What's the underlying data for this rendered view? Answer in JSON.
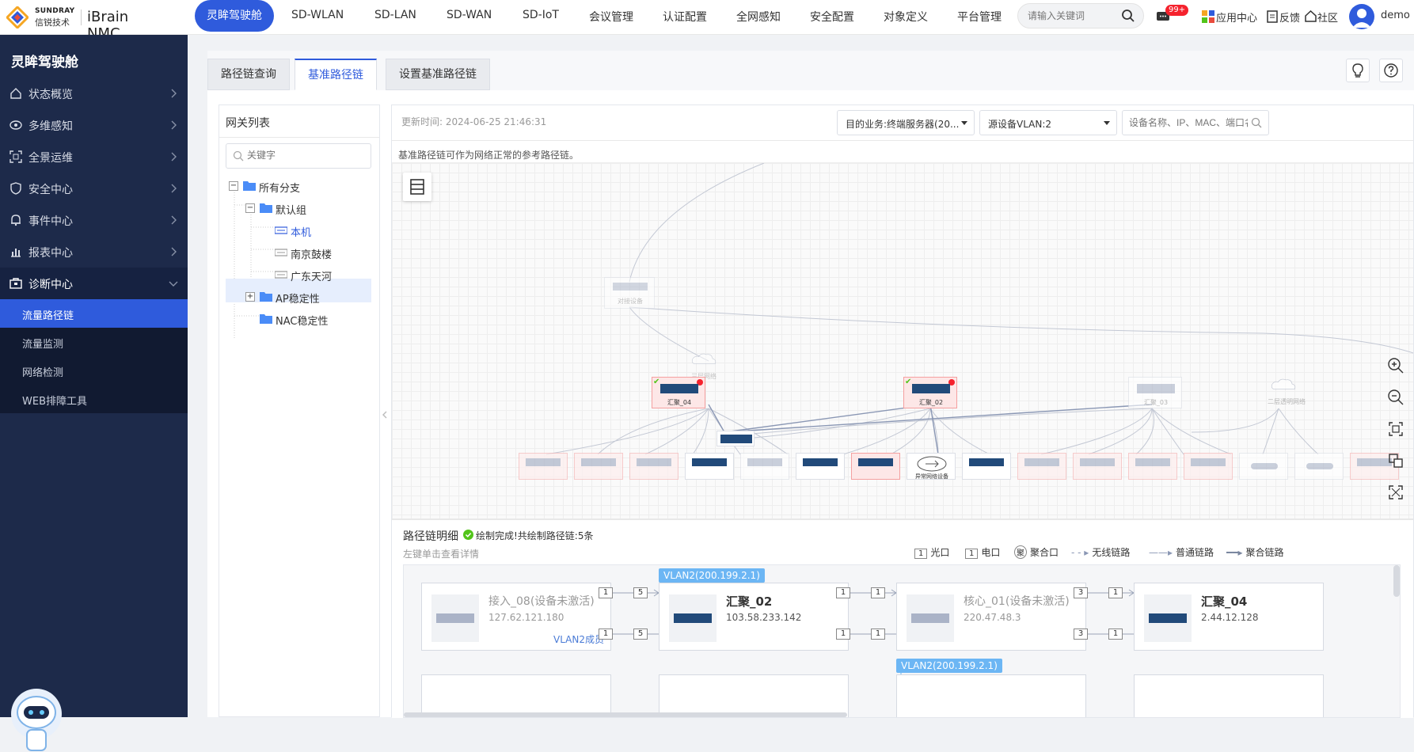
{
  "brand": {
    "company_en": "SUNDRAY",
    "company_cn": "信锐技术",
    "app": "iBrain NMC"
  },
  "nav": {
    "items": [
      "灵眸驾驶舱",
      "SD-WLAN",
      "SD-LAN",
      "SD-WAN",
      "SD-IoT",
      "会议管理",
      "认证配置",
      "全网感知",
      "安全配置",
      "对象定义",
      "平台管理"
    ],
    "active": "灵眸驾驶舱",
    "search_placeholder": "请输入关键词",
    "badge": "99+",
    "app_center": "应用中心",
    "feedback": "反馈",
    "community": "社区",
    "user": "demo"
  },
  "sidebar": {
    "title": "灵眸驾驶舱",
    "items": [
      {
        "label": "状态概览",
        "icon": "home-icon"
      },
      {
        "label": "多维感知",
        "icon": "eye-icon"
      },
      {
        "label": "全景运维",
        "icon": "scan-icon"
      },
      {
        "label": "安全中心",
        "icon": "shield-icon"
      },
      {
        "label": "事件中心",
        "icon": "bell-icon"
      },
      {
        "label": "报表中心",
        "icon": "bar-chart-icon"
      },
      {
        "label": "诊断中心",
        "icon": "toolbox-icon"
      }
    ],
    "sub_items": [
      "流量路径链",
      "流量监测",
      "网络检测",
      "WEB排障工具"
    ],
    "active_sub": "流量路径链"
  },
  "tabs": [
    "路径链查询",
    "基准路径链",
    "设置基准路径链"
  ],
  "active_tab": "基准路径链",
  "gateway": {
    "title": "网关列表",
    "search_placeholder": "关键字",
    "tree": [
      {
        "label": "所有分支",
        "type": "folder",
        "toggle": "−"
      },
      {
        "label": "默认组",
        "type": "folder",
        "toggle": "−"
      },
      {
        "label": "本机",
        "type": "device",
        "selected": true
      },
      {
        "label": "南京鼓楼",
        "type": "device"
      },
      {
        "label": "广东天河",
        "type": "device"
      },
      {
        "label": "AP稳定性",
        "type": "folder",
        "toggle": "+"
      },
      {
        "label": "NAC稳定性",
        "type": "folder"
      }
    ]
  },
  "main": {
    "update_time": "更新时间:   2024-06-25 21:46:31",
    "target_select": "目的业务:终端服务器(20...",
    "vlan_select": "源设备VLAN:2",
    "device_search_placeholder": "设备名称、IP、MAC、端口名称",
    "hint": "基准路径链可作为网络正常的参考路径链。"
  },
  "topology": {
    "nodes": [
      {
        "label": "对接设备",
        "dim": true
      },
      {
        "label": "三层网络",
        "dim": true
      },
      {
        "label": "汇聚_04",
        "alert": true
      },
      {
        "label": "汇聚_02",
        "alert": true
      },
      {
        "label": "汇聚_03",
        "dim": true
      },
      {
        "label": "二层透明网络",
        "dim": true
      },
      {
        "label": "异常网络设备"
      }
    ]
  },
  "detail": {
    "title": "路径链明细",
    "status": "绘制完成!共绘制路径链:5条",
    "subtitle": "左键单击查看详情",
    "legend": [
      {
        "mark": "1",
        "label": "光口"
      },
      {
        "mark": "1",
        "label": "电口"
      },
      {
        "mark": "聚",
        "label": "聚合口"
      },
      {
        "mark": "- - ▸",
        "label": "无线链路"
      },
      {
        "mark": "——▸",
        "label": "普通链路"
      },
      {
        "mark": "━━▸",
        "label": "聚合链路"
      }
    ],
    "row1": {
      "vlan_tag_1": "VLAN2(200.199.2.1)",
      "devices": [
        {
          "name": "接入_08(设备未激活)",
          "ip": "127.62.121.180",
          "extra": "VLAN2成员",
          "dim": true
        },
        {
          "name": "汇聚_02",
          "ip": "103.58.233.142",
          "extra": "",
          "dim": false
        },
        {
          "name": "核心_01(设备未激活)",
          "ip": "220.47.48.3",
          "extra": "",
          "dim": true
        },
        {
          "name": "汇聚_04",
          "ip": "2.44.12.128",
          "extra": "",
          "dim": false
        }
      ],
      "ports": [
        [
          "1",
          "5"
        ],
        [
          "1",
          "5"
        ],
        [
          "1",
          "1"
        ],
        [
          "1",
          "1"
        ],
        [
          "3",
          "1"
        ],
        [
          "3",
          "1"
        ]
      ]
    },
    "row2": {
      "vlan_tag": "VLAN2(200.199.2.1)"
    }
  },
  "colors": {
    "accent": "#2f5bdc",
    "sidebar": "#1d2a4a",
    "alert": "#f5222d",
    "vlan": "#6cb6f4"
  }
}
